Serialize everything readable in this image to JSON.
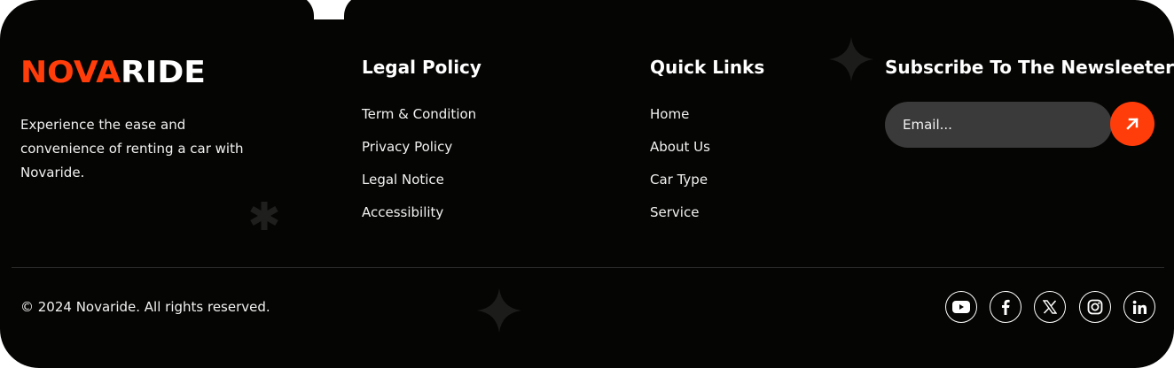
{
  "brand": {
    "name_part1": "NOVA",
    "name_part2": "RIDE",
    "accent_color": "#ff3d0a",
    "tagline": "Experience the ease and convenience of renting a car with Novaride."
  },
  "legal": {
    "title": "Legal Policy",
    "links": [
      "Term & Condition",
      "Privacy Policy",
      "Legal Notice",
      "Accessibility"
    ]
  },
  "quick": {
    "title": "Quick Links",
    "links": [
      "Home",
      "About Us",
      "Car Type",
      "Service"
    ]
  },
  "newsletter": {
    "title": "Subscribe To The Newsleeters",
    "placeholder": "Email...",
    "submit_icon": "arrow-up-right-icon"
  },
  "bottom": {
    "copyright": "© 2024 Novaride. All rights reserved."
  },
  "social": [
    "youtube-icon",
    "facebook-icon",
    "x-icon",
    "instagram-icon",
    "linkedin-icon"
  ],
  "colors": {
    "background": "#050503",
    "accent": "#ff3d0a",
    "input_bg": "#3a3a3a",
    "divider": "#2c2c2c"
  }
}
